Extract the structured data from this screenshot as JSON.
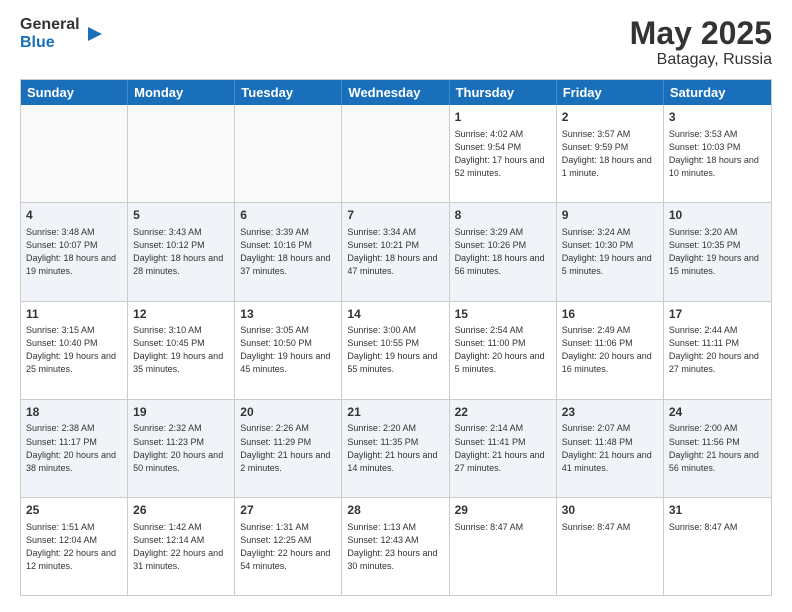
{
  "header": {
    "logo_line1": "General",
    "logo_line2": "Blue",
    "month_year": "May 2025",
    "location": "Batagay, Russia"
  },
  "days_of_week": [
    "Sunday",
    "Monday",
    "Tuesday",
    "Wednesday",
    "Thursday",
    "Friday",
    "Saturday"
  ],
  "weeks": [
    [
      {
        "day": "",
        "info": ""
      },
      {
        "day": "",
        "info": ""
      },
      {
        "day": "",
        "info": ""
      },
      {
        "day": "",
        "info": ""
      },
      {
        "day": "1",
        "info": "Sunrise: 4:02 AM\nSunset: 9:54 PM\nDaylight: 17 hours and 52 minutes."
      },
      {
        "day": "2",
        "info": "Sunrise: 3:57 AM\nSunset: 9:59 PM\nDaylight: 18 hours and 1 minute."
      },
      {
        "day": "3",
        "info": "Sunrise: 3:53 AM\nSunset: 10:03 PM\nDaylight: 18 hours and 10 minutes."
      }
    ],
    [
      {
        "day": "4",
        "info": "Sunrise: 3:48 AM\nSunset: 10:07 PM\nDaylight: 18 hours and 19 minutes."
      },
      {
        "day": "5",
        "info": "Sunrise: 3:43 AM\nSunset: 10:12 PM\nDaylight: 18 hours and 28 minutes."
      },
      {
        "day": "6",
        "info": "Sunrise: 3:39 AM\nSunset: 10:16 PM\nDaylight: 18 hours and 37 minutes."
      },
      {
        "day": "7",
        "info": "Sunrise: 3:34 AM\nSunset: 10:21 PM\nDaylight: 18 hours and 47 minutes."
      },
      {
        "day": "8",
        "info": "Sunrise: 3:29 AM\nSunset: 10:26 PM\nDaylight: 18 hours and 56 minutes."
      },
      {
        "day": "9",
        "info": "Sunrise: 3:24 AM\nSunset: 10:30 PM\nDaylight: 19 hours and 5 minutes."
      },
      {
        "day": "10",
        "info": "Sunrise: 3:20 AM\nSunset: 10:35 PM\nDaylight: 19 hours and 15 minutes."
      }
    ],
    [
      {
        "day": "11",
        "info": "Sunrise: 3:15 AM\nSunset: 10:40 PM\nDaylight: 19 hours and 25 minutes."
      },
      {
        "day": "12",
        "info": "Sunrise: 3:10 AM\nSunset: 10:45 PM\nDaylight: 19 hours and 35 minutes."
      },
      {
        "day": "13",
        "info": "Sunrise: 3:05 AM\nSunset: 10:50 PM\nDaylight: 19 hours and 45 minutes."
      },
      {
        "day": "14",
        "info": "Sunrise: 3:00 AM\nSunset: 10:55 PM\nDaylight: 19 hours and 55 minutes."
      },
      {
        "day": "15",
        "info": "Sunrise: 2:54 AM\nSunset: 11:00 PM\nDaylight: 20 hours and 5 minutes."
      },
      {
        "day": "16",
        "info": "Sunrise: 2:49 AM\nSunset: 11:06 PM\nDaylight: 20 hours and 16 minutes."
      },
      {
        "day": "17",
        "info": "Sunrise: 2:44 AM\nSunset: 11:11 PM\nDaylight: 20 hours and 27 minutes."
      }
    ],
    [
      {
        "day": "18",
        "info": "Sunrise: 2:38 AM\nSunset: 11:17 PM\nDaylight: 20 hours and 38 minutes."
      },
      {
        "day": "19",
        "info": "Sunrise: 2:32 AM\nSunset: 11:23 PM\nDaylight: 20 hours and 50 minutes."
      },
      {
        "day": "20",
        "info": "Sunrise: 2:26 AM\nSunset: 11:29 PM\nDaylight: 21 hours and 2 minutes."
      },
      {
        "day": "21",
        "info": "Sunrise: 2:20 AM\nSunset: 11:35 PM\nDaylight: 21 hours and 14 minutes."
      },
      {
        "day": "22",
        "info": "Sunrise: 2:14 AM\nSunset: 11:41 PM\nDaylight: 21 hours and 27 minutes."
      },
      {
        "day": "23",
        "info": "Sunrise: 2:07 AM\nSunset: 11:48 PM\nDaylight: 21 hours and 41 minutes."
      },
      {
        "day": "24",
        "info": "Sunrise: 2:00 AM\nSunset: 11:56 PM\nDaylight: 21 hours and 56 minutes."
      }
    ],
    [
      {
        "day": "25",
        "info": "Sunrise: 1:51 AM\nSunset: 12:04 AM\nDaylight: 22 hours and 12 minutes."
      },
      {
        "day": "26",
        "info": "Sunrise: 1:42 AM\nSunset: 12:14 AM\nDaylight: 22 hours and 31 minutes."
      },
      {
        "day": "27",
        "info": "Sunrise: 1:31 AM\nSunset: 12:25 AM\nDaylight: 22 hours and 54 minutes."
      },
      {
        "day": "28",
        "info": "Sunrise: 1:13 AM\nSunset: 12:43 AM\nDaylight: 23 hours and 30 minutes."
      },
      {
        "day": "29",
        "info": "Sunrise: 8:47 AM"
      },
      {
        "day": "30",
        "info": "Sunrise: 8:47 AM"
      },
      {
        "day": "31",
        "info": "Sunrise: 8:47 AM"
      }
    ]
  ]
}
